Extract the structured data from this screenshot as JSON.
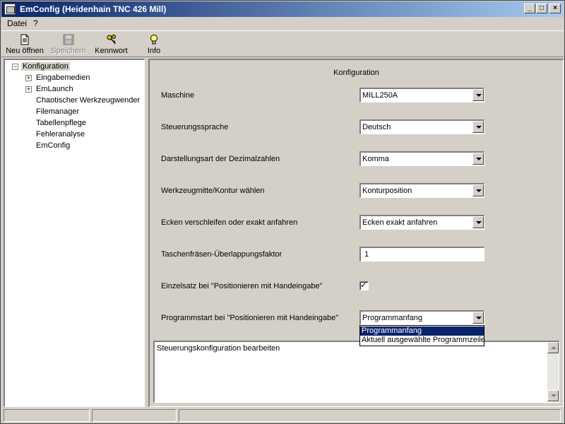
{
  "window": {
    "title": "EmConfig (Heidenhain TNC 426 Mill)",
    "minimize_label": "_",
    "maximize_label": "□",
    "close_label": "×"
  },
  "menu": {
    "items": [
      {
        "label": "Datei"
      },
      {
        "label": "?"
      }
    ]
  },
  "toolbar": {
    "new_open": {
      "label": "Neu öffnen",
      "icon": "document-icon",
      "enabled": true
    },
    "save": {
      "label": "Speichern",
      "icon": "floppy-disk-icon",
      "enabled": false
    },
    "password": {
      "label": "Kennwort",
      "icon": "keys-icon",
      "enabled": true
    },
    "info": {
      "label": "Info",
      "icon": "lightbulb-icon",
      "enabled": true
    }
  },
  "tree": {
    "root": {
      "label": "Konfiguration",
      "expander": "−",
      "selected": true
    },
    "items": [
      {
        "label": "Eingabemedien",
        "expander": "+"
      },
      {
        "label": "EmLaunch",
        "expander": "+"
      },
      {
        "label": "Chaotischer Werkzeugwender"
      },
      {
        "label": "Filemanager"
      },
      {
        "label": "Tabellenpflege"
      },
      {
        "label": "Fehleranalyse"
      },
      {
        "label": "EmConfig"
      }
    ]
  },
  "form": {
    "title": "Konfiguration",
    "fields": [
      {
        "label": "Maschine",
        "value": "MILL250A",
        "control": "combo"
      },
      {
        "label": "Steuerungssprache",
        "value": "Deutsch",
        "control": "combo"
      },
      {
        "label": "Darstellungsart der Dezimalzahlen",
        "value": "Komma",
        "control": "combo"
      },
      {
        "label": "Werkzeugmitte/Kontur wählen",
        "value": "Konturposition",
        "control": "combo"
      },
      {
        "label": "Ecken verschleifen oder exakt anfahren",
        "value": "Ecken exakt anfahren",
        "control": "combo"
      },
      {
        "label": "Taschenfräsen-Überlappungsfaktor",
        "value": "1",
        "control": "text"
      },
      {
        "label": "Einzelsatz bei \"Positionieren mit Handeingabe\"",
        "checked": true,
        "check_mark": "✓",
        "control": "checkbox"
      },
      {
        "label": "Programmstart bei \"Positionieren mit Handeingabe\"",
        "value": "Programmanfang",
        "control": "combo"
      }
    ],
    "dropdown_options": [
      {
        "label": "Programmanfang",
        "selected": true
      },
      {
        "label": "Aktuell ausgewählte Programmzeile",
        "selected": false
      }
    ]
  },
  "description": {
    "text": "Steuerungskonfiguration bearbeiten"
  },
  "colors": {
    "titlebar_start": "#0a246a",
    "titlebar_end": "#a6caf0",
    "face": "#d4d0c8",
    "selection": "#0a246a"
  }
}
